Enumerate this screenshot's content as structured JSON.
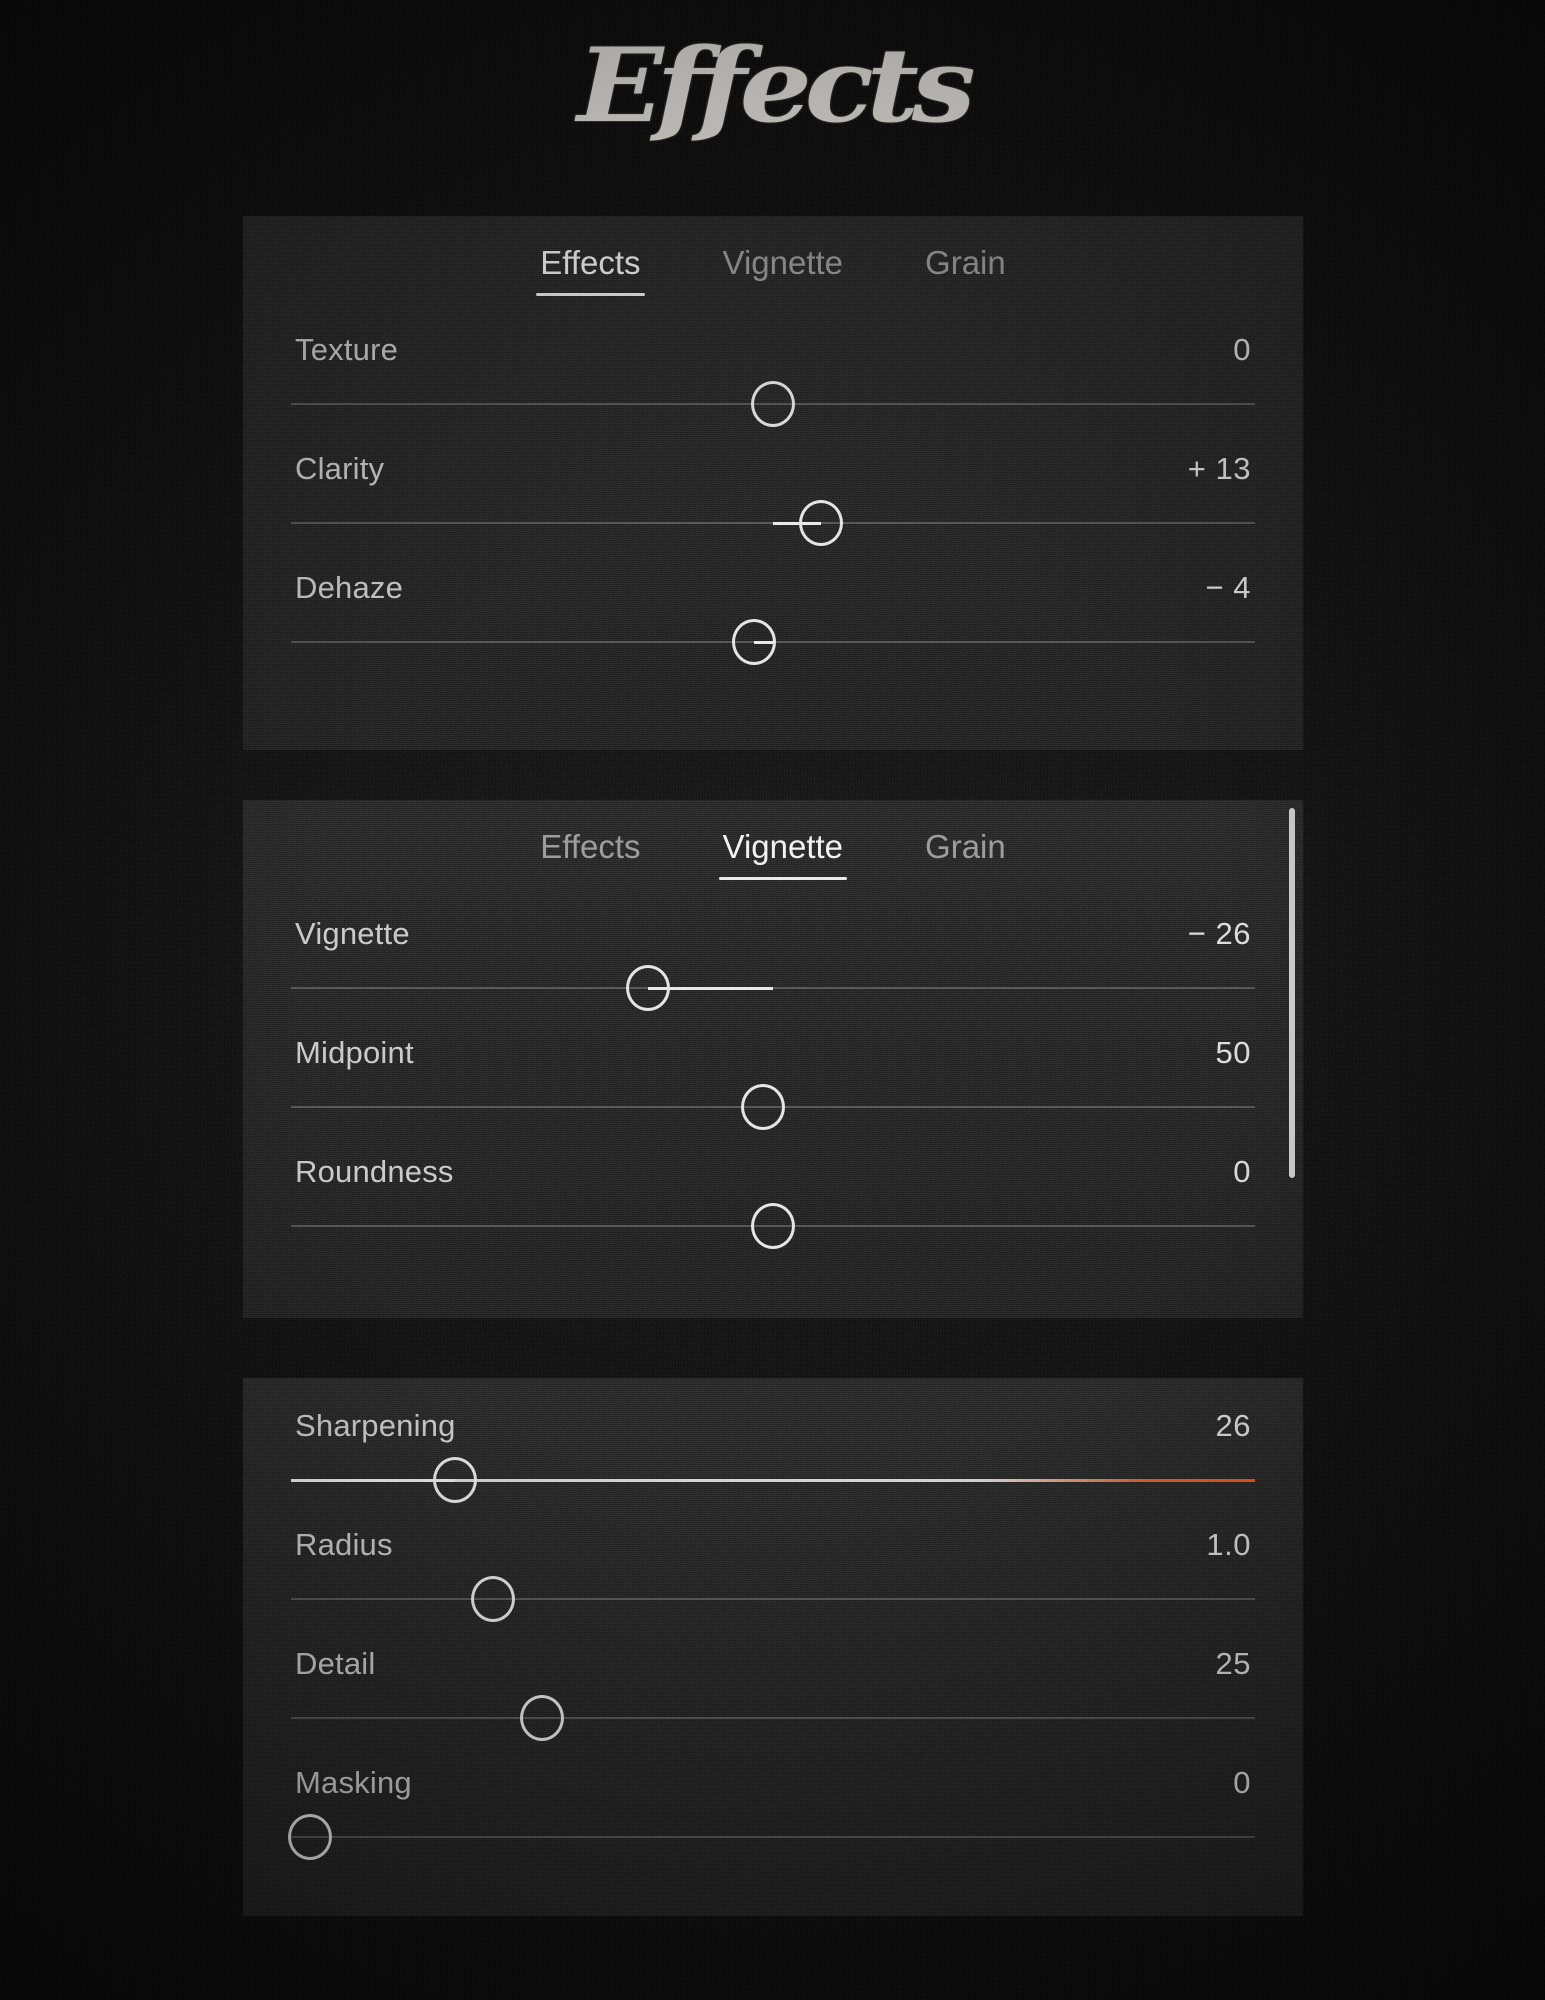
{
  "page": {
    "title": "Effects",
    "background_color": "#0a0a0a",
    "panel_color": "#202020",
    "accent_color": "#f2561a"
  },
  "panels": [
    {
      "id": "effects",
      "tabs": [
        {
          "label": "Effects",
          "active": true
        },
        {
          "label": "Vignette",
          "active": false
        },
        {
          "label": "Grain",
          "active": false
        }
      ],
      "sliders": [
        {
          "label": "Texture",
          "value": "0",
          "knob_pct": 50,
          "fill_from_pct": 50,
          "fill_to_pct": 50,
          "style": "dim"
        },
        {
          "label": "Clarity",
          "value": "+ 13",
          "knob_pct": 55,
          "fill_from_pct": 50,
          "fill_to_pct": 55,
          "style": "dim"
        },
        {
          "label": "Dehaze",
          "value": "− 4",
          "knob_pct": 48,
          "fill_from_pct": 48,
          "fill_to_pct": 50,
          "style": "dim"
        }
      ],
      "scrollbar": false
    },
    {
      "id": "vignette",
      "tabs": [
        {
          "label": "Effects",
          "active": false
        },
        {
          "label": "Vignette",
          "active": true
        },
        {
          "label": "Grain",
          "active": false
        }
      ],
      "sliders": [
        {
          "label": "Vignette",
          "value": "− 26",
          "knob_pct": 37,
          "fill_from_pct": 37,
          "fill_to_pct": 50,
          "style": "dim"
        },
        {
          "label": "Midpoint",
          "value": "50",
          "knob_pct": 49,
          "fill_from_pct": 49,
          "fill_to_pct": 49,
          "style": "dim"
        },
        {
          "label": "Roundness",
          "value": "0",
          "knob_pct": 50,
          "fill_from_pct": 50,
          "fill_to_pct": 50,
          "style": "dim"
        }
      ],
      "scrollbar": true
    },
    {
      "id": "detail",
      "tabs": [],
      "sliders": [
        {
          "label": "Sharpening",
          "value": "26",
          "knob_pct": 17,
          "fill_from_pct": 0,
          "fill_to_pct": 17,
          "style": "gradient"
        },
        {
          "label": "Radius",
          "value": "1.0",
          "knob_pct": 21,
          "fill_from_pct": 21,
          "fill_to_pct": 21,
          "style": "dim"
        },
        {
          "label": "Detail",
          "value": "25",
          "knob_pct": 26,
          "fill_from_pct": 26,
          "fill_to_pct": 26,
          "style": "dim"
        },
        {
          "label": "Masking",
          "value": "0",
          "knob_pct": 2,
          "fill_from_pct": 2,
          "fill_to_pct": 2,
          "style": "dim"
        }
      ],
      "scrollbar": false
    }
  ]
}
